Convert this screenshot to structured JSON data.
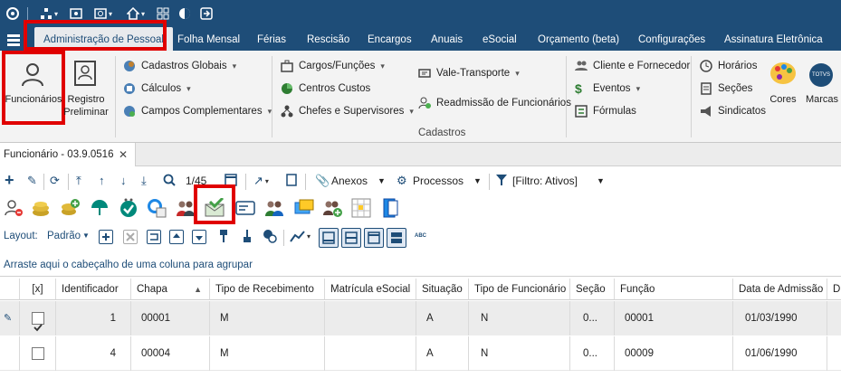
{
  "ribbon_tabs": [
    "Administração de Pessoal",
    "Folha Mensal",
    "Férias",
    "Rescisão",
    "Encargos",
    "Anuais",
    "eSocial",
    "Orçamento (beta)",
    "Configurações",
    "Assinatura Eletrônica"
  ],
  "ribbon": {
    "funcionarios": "Funcionários",
    "registro_line1": "Registro",
    "registro_line2": "Preliminar",
    "cadastros_globais": "Cadastros Globais",
    "calculos": "Cálculos",
    "campos_complementares": "Campos Complementares",
    "cargos_funcoes": "Cargos/Funções",
    "centros_custos": "Centros Custos",
    "chefes_supervisores": "Chefes e Supervisores",
    "vale_transporte": "Vale-Transporte",
    "readmissao": "Readmissão de Funcionários",
    "cliente_fornecedor": "Cliente e Fornecedor",
    "eventos": "Eventos",
    "formulas": "Fórmulas",
    "horarios": "Horários",
    "secoes": "Seções",
    "sindicatos": "Sindicatos",
    "cores": "Cores",
    "marcas": "Marcas",
    "totvs_badge": "TOTVS",
    "group_label": "Cadastros"
  },
  "doc_tab": {
    "title": "Funcionário - 03.9.0516",
    "close": "✕"
  },
  "toolbar1": {
    "page": "1/45",
    "anexos": "Anexos",
    "processos": "Processos",
    "filtro": "[Filtro: Ativos]"
  },
  "layout_row": {
    "label": "Layout:",
    "value": "Padrão"
  },
  "group_by_hint": "Arraste aqui o cabeçalho de uma coluna para agrupar",
  "table": {
    "select_all": "[x]",
    "headers": [
      "Identificador",
      "Chapa",
      "Tipo de Recebimento",
      "Matrícula eSocial",
      "Situação",
      "Tipo de Funcionário",
      "Seção",
      "Função",
      "Data de Admissão",
      "D"
    ],
    "rows": [
      {
        "checked": true,
        "id": "1",
        "chapa": "00001",
        "tipo_rec": "M",
        "matricula": "",
        "situacao": "A",
        "tipo_func": "N",
        "secao": "0...",
        "funcao": "00001",
        "admissao": "01/03/1990"
      },
      {
        "checked": false,
        "id": "4",
        "chapa": "00004",
        "tipo_rec": "M",
        "matricula": "",
        "situacao": "A",
        "tipo_func": "N",
        "secao": "0...",
        "funcao": "00009",
        "admissao": "01/06/1990"
      }
    ]
  },
  "colors": {
    "brand": "#1e4d78",
    "highlight": "#e00000"
  }
}
